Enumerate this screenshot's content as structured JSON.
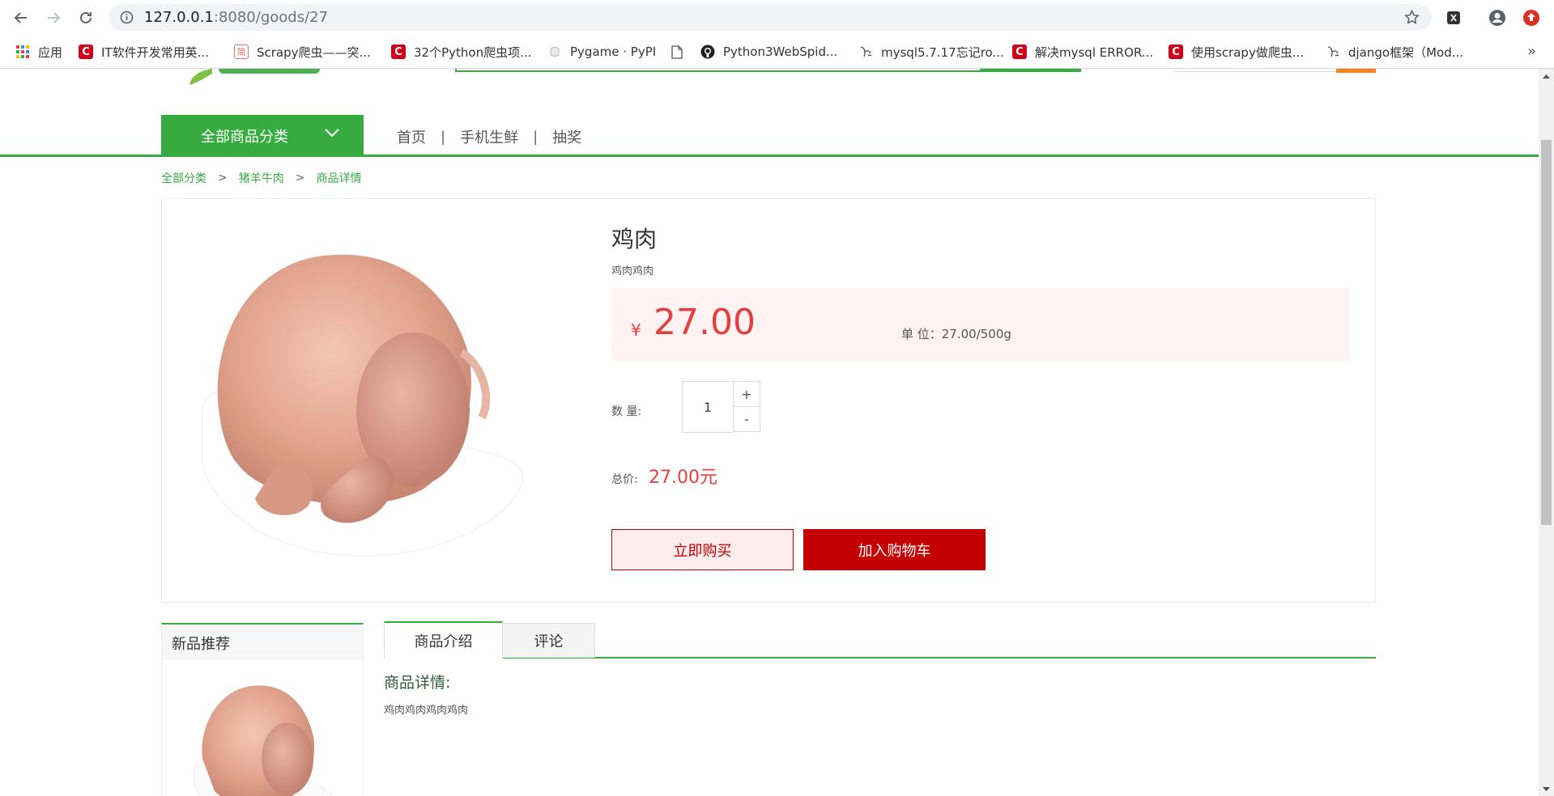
{
  "browser": {
    "url_host": "127.0.0.1",
    "url_rest": ":8080/goods/27",
    "bookmarks": [
      {
        "label": "应用",
        "icon": "apps-grid-icon"
      },
      {
        "label": "IT软件开发常用英...",
        "icon": "csdn-icon"
      },
      {
        "label": "Scrapy爬虫——突...",
        "icon": "jianshu-icon"
      },
      {
        "label": "32个Python爬虫项...",
        "icon": "csdn-icon"
      },
      {
        "label": "Pygame · PyPI",
        "icon": "pypi-icon"
      },
      {
        "label": "",
        "icon": "page-icon"
      },
      {
        "label": "Python3WebSpid...",
        "icon": "github-icon"
      },
      {
        "label": "mysql5.7.17忘记ro...",
        "icon": "blog-icon"
      },
      {
        "label": "解决mysql ERROR...",
        "icon": "csdn-icon"
      },
      {
        "label": "使用scrapy做爬虫...",
        "icon": "csdn-icon"
      },
      {
        "label": "django框架（Mod...",
        "icon": "blog-icon"
      }
    ],
    "more_label": "»"
  },
  "nav": {
    "all_categories": "全部商品分类",
    "links": [
      "首页",
      "手机生鲜",
      "抽奖"
    ],
    "separator": "|"
  },
  "breadcrumb": {
    "items": [
      "全部分类",
      "猪羊牛肉",
      "商品详情"
    ],
    "separator": ">"
  },
  "product": {
    "name": "鸡肉",
    "subtitle": "鸡肉鸡肉",
    "currency": "¥",
    "price": "27.00",
    "unit": "单  位：27.00/500g",
    "qty_label": "数  量:",
    "quantity": "1",
    "plus": "+",
    "minus": "-",
    "total_label": "总价:",
    "total_value": "27.00元",
    "buy_now": "立即购买",
    "add_to_cart": "加入购物车"
  },
  "sidebar": {
    "title": "新品推荐"
  },
  "tabs": {
    "intro": "商品介绍",
    "comments": "评论"
  },
  "detail": {
    "title": "商品详情:",
    "text": "鸡肉鸡肉鸡肉鸡肉"
  },
  "colors": {
    "brand_green": "#37ab40",
    "price_red": "#e53e3e",
    "cart_red": "#c40000"
  }
}
